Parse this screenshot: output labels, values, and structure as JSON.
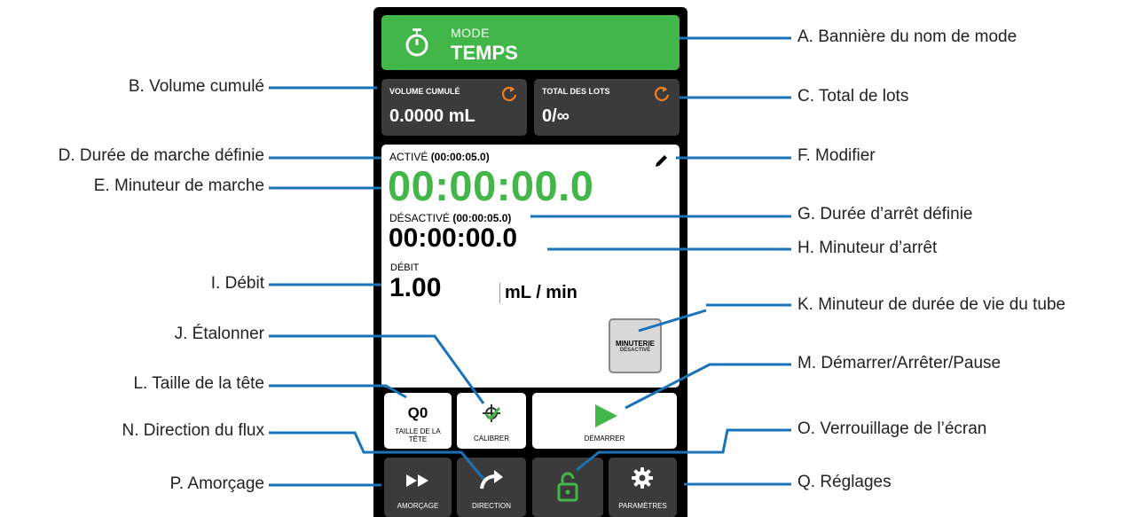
{
  "device": {
    "banner": {
      "mode_label": "MODE",
      "mode_name": "TEMPS"
    },
    "volume": {
      "label": "VOLUME CUMULÉ",
      "value": "0.0000 mL"
    },
    "batches": {
      "label": "TOTAL DES LOTS",
      "value": "0/∞"
    },
    "run": {
      "active_label": "ACTIVÉ",
      "active_set": "(00:00:05.0)",
      "active_timer": "00:00:00.0",
      "off_label": "DÉSACTIVÉ",
      "off_set": "(00:00:05.0)",
      "off_timer": "00:00:00.0",
      "flow_label": "DÉBIT",
      "flow_value": "1.00",
      "flow_unit": "mL / min",
      "tube_timer_line1": "MINUTERIE",
      "tube_timer_line2": "DÉSACTIVÉ"
    },
    "buttons": {
      "head_size_value": "Q0",
      "head_size_label": "TAILLE DE LA TÊTE",
      "calibrate": "CALIBRER",
      "start": "DÉMARRER",
      "prime": "AMORÇAGE",
      "direction": "DIRECTION",
      "settings": "PARAMÈTRES"
    },
    "colors": {
      "green": "#43b649",
      "dark": "#3b3b3b",
      "orange": "#f07f1f",
      "leader": "#1a73b8"
    }
  },
  "callouts": {
    "a": "A. Bannière du nom de mode",
    "b": "B. Volume cumulé",
    "c": "C. Total de lots",
    "d": "D. Durée de marche définie",
    "e": "E. Minuteur de marche",
    "f": "F. Modifier",
    "g": "G. Durée d’arrêt définie",
    "h": "H. Minuteur d’arrêt",
    "i": "I. Débit",
    "j": "J. Étalonner",
    "k": "K. Minuteur de durée de vie du tube",
    "l": "L. Taille de la tête",
    "m": "M. Démarrer/Arrêter/Pause",
    "n": "N. Direction du flux",
    "o": "O. Verrouillage de l’écran",
    "p": "P. Amorçage",
    "q": "Q. Réglages"
  }
}
